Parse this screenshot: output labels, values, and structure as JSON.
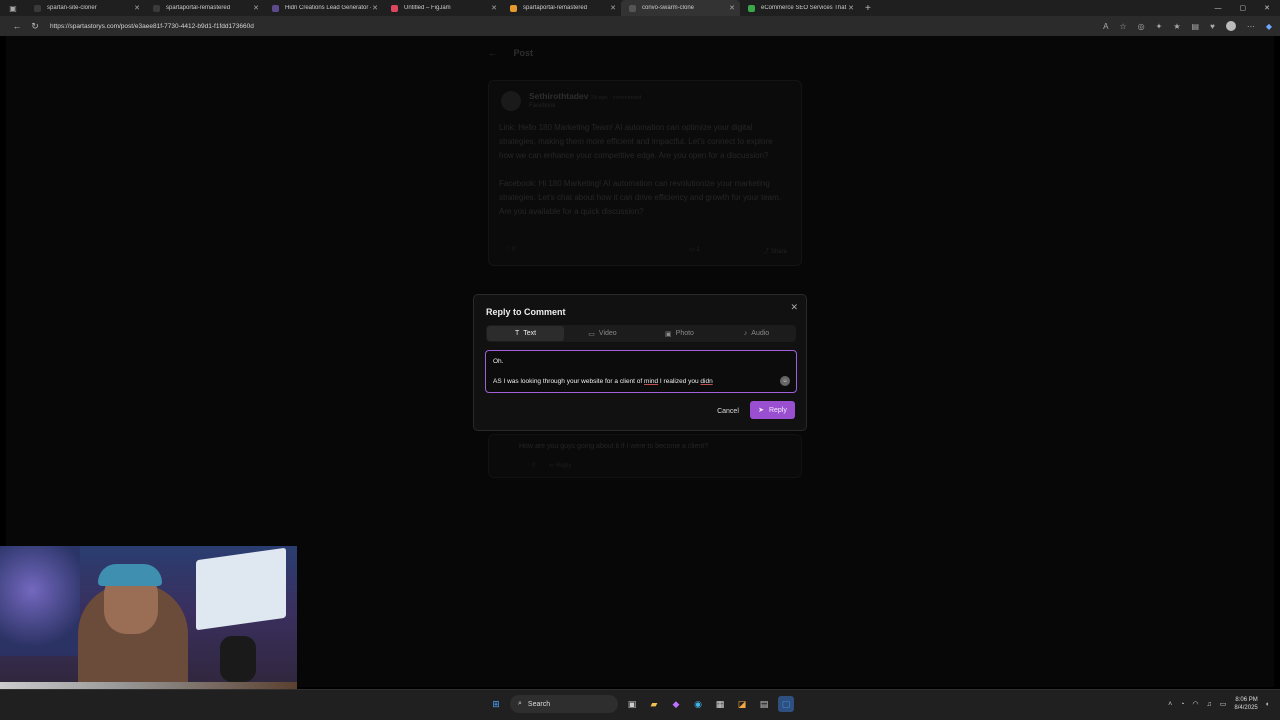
{
  "browser": {
    "tabs": [
      {
        "label": "spartan-site-cloner",
        "color": "#3a3a3a",
        "active": false
      },
      {
        "label": "spartaportal-remastered",
        "color": "#3a3a3a",
        "active": false
      },
      {
        "label": "Hidn Creations Lead Generator -",
        "color": "#5b4b8a",
        "active": false
      },
      {
        "label": "Untitled – FigJam",
        "color": "#e0455f",
        "active": false
      },
      {
        "label": "spartaportal-remastered",
        "color": "#e59a2f",
        "active": false
      },
      {
        "label": "convo-swarm-clone",
        "color": "#555555",
        "active": true
      },
      {
        "label": "eCommerce SEO Services That A",
        "color": "#3aa84a",
        "active": false
      }
    ],
    "url": "https://spartastorys.com/post/e3aee81f-7730-4412-b9d1-f1fdd173660d"
  },
  "page": {
    "header": {
      "title": "Post"
    },
    "post": {
      "author": "Sethirothtadev",
      "author_note": "2d ago · commented",
      "handle": "Facebook",
      "paragraph1": "Link: Hello 180 Marketing Team! AI automation can optimize your digital strategies, making them more efficient and impactful. Let's connect to explore how we can enhance your competitive edge. Are you open for a discussion?",
      "paragraph2": "Facebook: Hi 180 Marketing! AI automation can revolutionize your marketing strategies. Let's chat about how it can drive efficiency and growth for your team. Are you available for a quick discussion?",
      "likes": "0",
      "comments": "1",
      "share_label": "Share"
    },
    "comment": {
      "text": "How are you guys going about it if I were to become a client?",
      "likes": "0",
      "reply_label": "Reply"
    }
  },
  "modal": {
    "title": "Reply to Comment",
    "tabs": [
      {
        "label": "Text",
        "icon": "T",
        "active": true
      },
      {
        "label": "Video",
        "icon": "▭",
        "active": false
      },
      {
        "label": "Photo",
        "icon": "▣",
        "active": false
      },
      {
        "label": "Audio",
        "icon": "♪",
        "active": false
      }
    ],
    "reply_line1": "Oh.",
    "reply_line2_a": "AS I was looking through your website for a client of ",
    "reply_line2_b": "mind",
    "reply_line2_c": " I realized you ",
    "reply_line2_d": "didn",
    "cancel_label": "Cancel",
    "reply_label": "Reply"
  },
  "taskbar": {
    "search_label": "Search",
    "time": "8:06 PM",
    "date": "8/4/2025"
  }
}
